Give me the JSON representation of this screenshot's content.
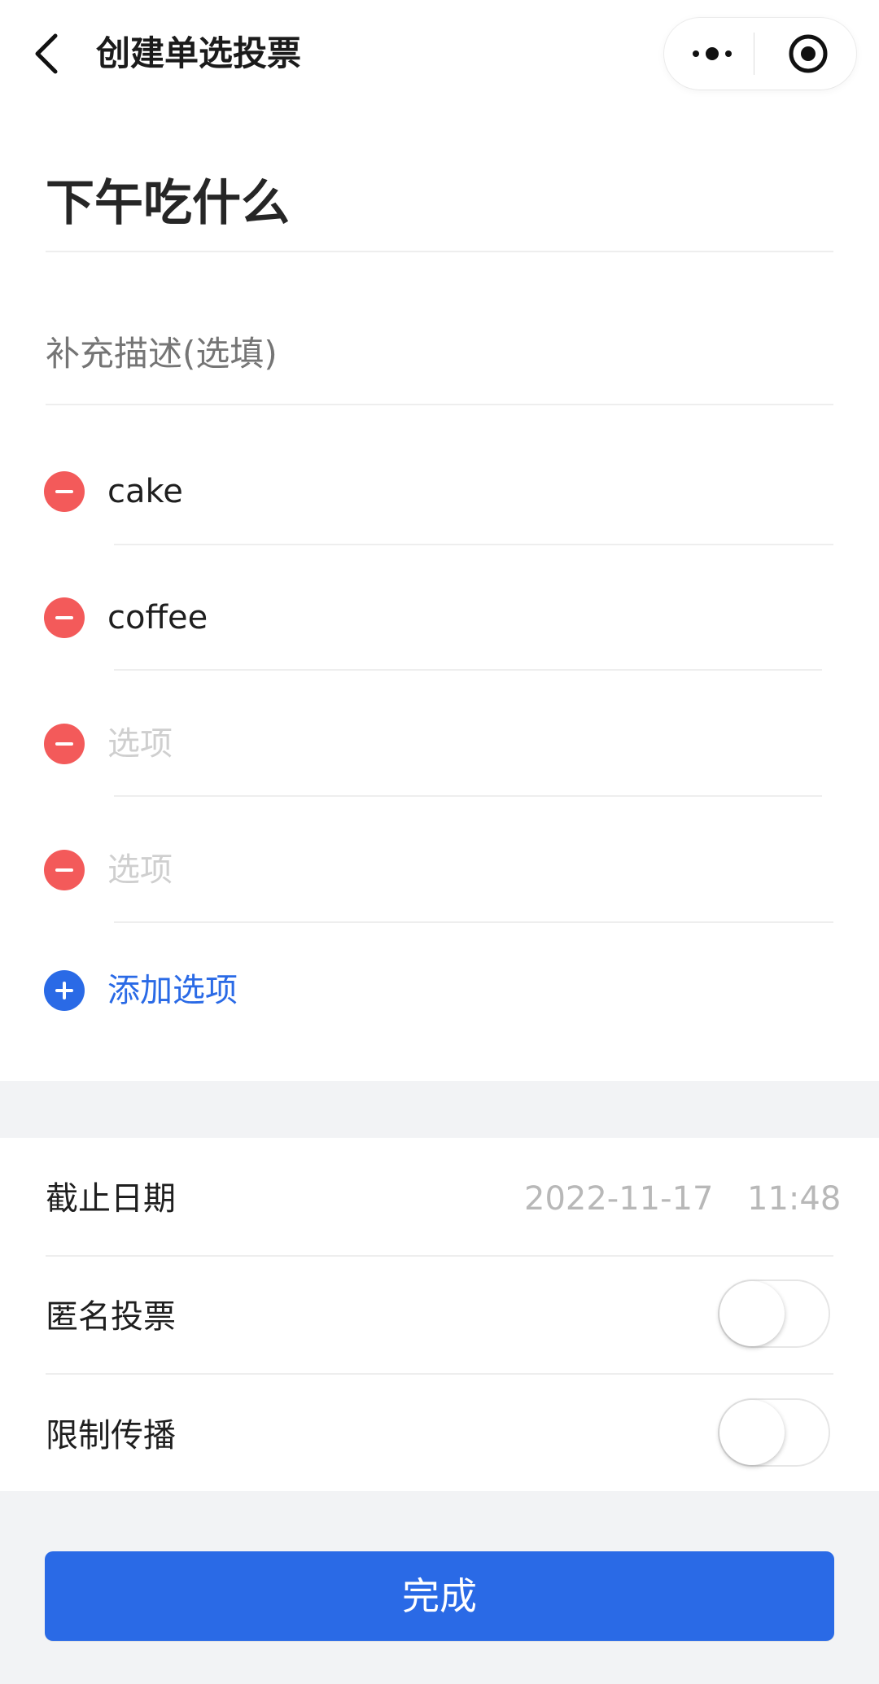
{
  "header": {
    "title": "创建单选投票",
    "icons": {
      "back": "back-arrow-icon",
      "more": "more-dots-icon",
      "close": "close-target-icon"
    }
  },
  "poll": {
    "title": "下午吃什么",
    "description_placeholder": "补充描述(选填)",
    "options": [
      {
        "value": "cake",
        "placeholder": "选项"
      },
      {
        "value": "coffee",
        "placeholder": "选项"
      },
      {
        "value": "",
        "placeholder": "选项"
      },
      {
        "value": "",
        "placeholder": "选项"
      }
    ],
    "add_option_label": "添加选项"
  },
  "settings": {
    "deadline": {
      "label": "截止日期",
      "date": "2022-11-17",
      "time": "11:48"
    },
    "anonymous": {
      "label": "匿名投票",
      "enabled": false
    },
    "restrict_share": {
      "label": "限制传播",
      "enabled": false
    }
  },
  "actions": {
    "done_label": "完成"
  },
  "colors": {
    "primary": "#2a6ae6",
    "danger": "#f35a5a",
    "divider": "#eeeeee",
    "bg_gray": "#f2f3f5"
  }
}
